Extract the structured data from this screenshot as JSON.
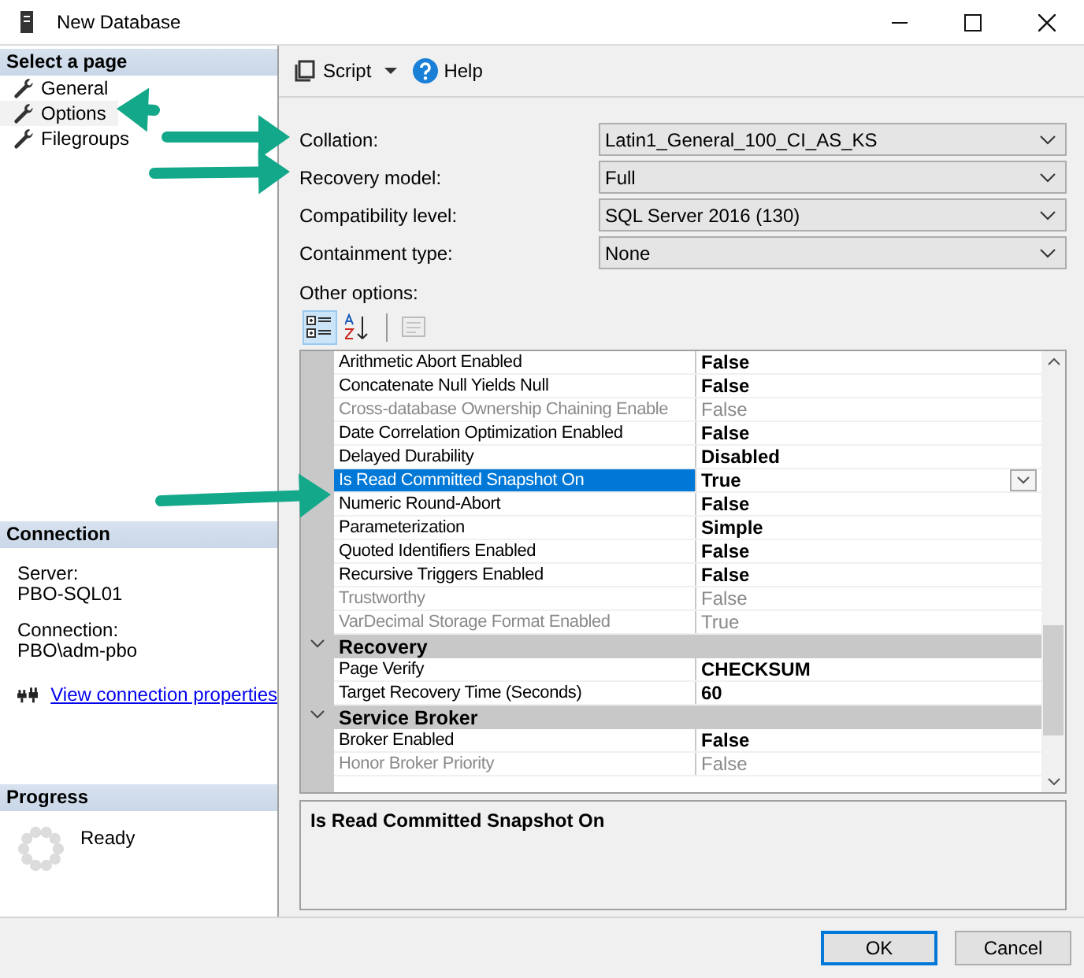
{
  "window": {
    "title": "New Database"
  },
  "select_page": {
    "title": "Select a page",
    "items": [
      {
        "label": "General",
        "selected": false
      },
      {
        "label": "Options",
        "selected": true
      },
      {
        "label": "Filegroups",
        "selected": false
      }
    ]
  },
  "connection": {
    "title": "Connection",
    "fields": [
      {
        "label": "Server:",
        "value": "PBO-SQL01"
      },
      {
        "label": "Connection:",
        "value": "PBO\\adm-pbo"
      }
    ],
    "link": "View connection properties"
  },
  "progress": {
    "title": "Progress",
    "status": "Ready"
  },
  "toolbar": {
    "script": "Script",
    "help": "Help"
  },
  "form": [
    {
      "label": "Collation:",
      "value": "Latin1_General_100_CI_AS_KS"
    },
    {
      "label": "Recovery model:",
      "value": "Full"
    },
    {
      "label": "Compatibility level:",
      "value": "SQL Server 2016 (130)"
    },
    {
      "label": "Containment type:",
      "value": "None"
    }
  ],
  "other_options_label": "Other options:",
  "grid_tools": [
    {
      "kind": "categorized",
      "selected": true,
      "disabled": false
    },
    {
      "kind": "alphabetical",
      "selected": false,
      "disabled": false
    },
    {
      "kind": "property_pages",
      "selected": false,
      "disabled": true
    }
  ],
  "properties": [
    {
      "kind": "property",
      "name": "Arithmetic Abort Enabled",
      "value": "False",
      "disabled": false,
      "selected": false
    },
    {
      "kind": "property",
      "name": "Concatenate Null Yields Null",
      "value": "False",
      "disabled": false,
      "selected": false
    },
    {
      "kind": "property",
      "name": "Cross-database Ownership Chaining Enable",
      "value": "False",
      "disabled": true,
      "selected": false
    },
    {
      "kind": "property",
      "name": "Date Correlation Optimization Enabled",
      "value": "False",
      "disabled": false,
      "selected": false
    },
    {
      "kind": "property",
      "name": "Delayed Durability",
      "value": "Disabled",
      "disabled": false,
      "selected": false
    },
    {
      "kind": "property",
      "name": "Is Read Committed Snapshot On",
      "value": "True",
      "disabled": false,
      "selected": true
    },
    {
      "kind": "property",
      "name": "Numeric Round-Abort",
      "value": "False",
      "disabled": false,
      "selected": false
    },
    {
      "kind": "property",
      "name": "Parameterization",
      "value": "Simple",
      "disabled": false,
      "selected": false
    },
    {
      "kind": "property",
      "name": "Quoted Identifiers Enabled",
      "value": "False",
      "disabled": false,
      "selected": false
    },
    {
      "kind": "property",
      "name": "Recursive Triggers Enabled",
      "value": "False",
      "disabled": false,
      "selected": false
    },
    {
      "kind": "property",
      "name": "Trustworthy",
      "value": "False",
      "disabled": true,
      "selected": false
    },
    {
      "kind": "property",
      "name": "VarDecimal Storage Format Enabled",
      "value": "True",
      "disabled": true,
      "selected": false
    },
    {
      "kind": "category",
      "name": "Recovery",
      "expanded": true
    },
    {
      "kind": "property",
      "name": "Page Verify",
      "value": "CHECKSUM",
      "disabled": false,
      "selected": false
    },
    {
      "kind": "property",
      "name": "Target Recovery Time (Seconds)",
      "value": "60",
      "disabled": false,
      "selected": false
    },
    {
      "kind": "category",
      "name": "Service Broker",
      "expanded": true
    },
    {
      "kind": "property",
      "name": "Broker Enabled",
      "value": "False",
      "disabled": false,
      "selected": false
    },
    {
      "kind": "property",
      "name": "Honor Broker Priority",
      "value": "False",
      "disabled": true,
      "selected": false
    }
  ],
  "description": "Is Read Committed Snapshot On",
  "buttons": [
    {
      "label": "OK",
      "default": true
    },
    {
      "label": "Cancel",
      "default": false
    }
  ]
}
